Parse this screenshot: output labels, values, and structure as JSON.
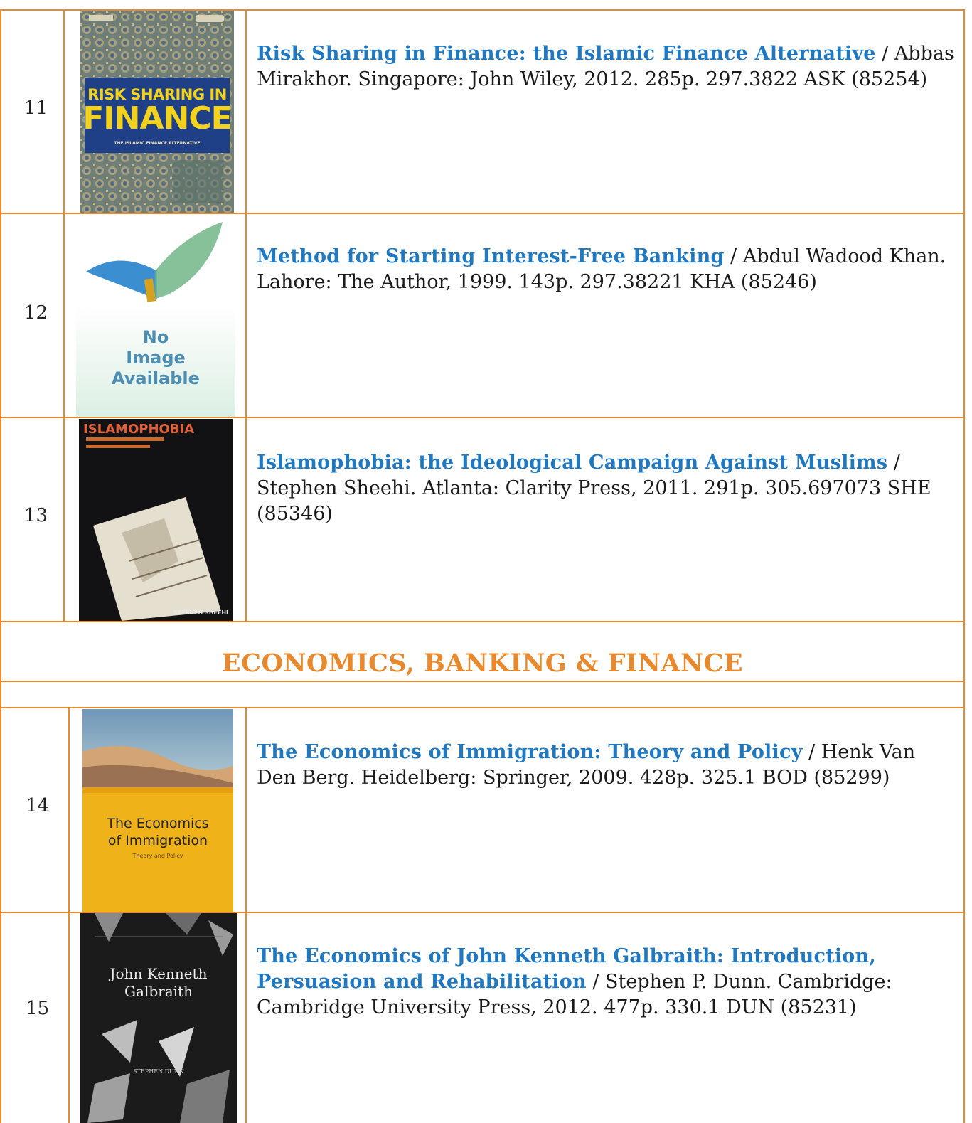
{
  "section_heading": "ECONOMICS, BANKING & FINANCE",
  "books": [
    {
      "number": "11",
      "title": "Risk Sharing in Finance: the Islamic Finance Alternative",
      "details": " / Abbas Mirakhor. Singapore: John Wiley, 2012. 285p. 297.3822 ASK (85254)",
      "cover": {
        "line1": "RISK SHARING IN",
        "line2": "FINANCE",
        "line3": "THE ISLAMIC FINANCE ALTERNATIVE"
      }
    },
    {
      "number": "12",
      "title": "Method for Starting Interest-Free Banking",
      "details": " / Abdul Wadood Khan. Lahore: The Author, 1999. 143p. 297.38221 KHA (85246)",
      "cover": {
        "line1": "No",
        "line2": "Image",
        "line3": "Available"
      }
    },
    {
      "number": "13",
      "title": "Islamophobia: the Ideological Campaign Against Muslims",
      "details": " / Stephen Sheehi. Atlanta: Clarity Press, 2011. 291p. 305.697073 SHE (85346)",
      "cover": {
        "line1": "ISLAMOPHOBIA",
        "line2": "STEPHEN SHEEHI"
      }
    },
    {
      "number": "14",
      "title": "The Economics of Immigration: Theory and Policy",
      "details": " / Henk Van Den Berg. Heidelberg: Springer, 2009. 428p. 325.1 BOD (85299)",
      "cover": {
        "line1": "The Economics",
        "line2": "of Immigration",
        "line3": "Theory and Policy"
      }
    },
    {
      "number": "15",
      "title": "The Economics of John Kenneth Galbraith: Introduction, Persuasion and Rehabilitation",
      "details": " / Stephen P. Dunn. Cambridge: Cambridge University Press, 2012. 477p. 330.1 DUN (85231)",
      "cover": {
        "line1": "John Kenneth",
        "line2": "Galbraith",
        "line3": "STEPHEN DUNN"
      }
    }
  ]
}
